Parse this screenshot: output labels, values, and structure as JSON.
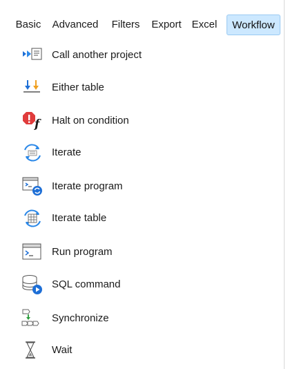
{
  "tabs": [
    {
      "label": "Basic",
      "active": false
    },
    {
      "label": "Advanced",
      "active": false
    },
    {
      "label": "Filters",
      "active": false
    },
    {
      "label": "Export",
      "active": false
    },
    {
      "label": "Excel",
      "active": false
    },
    {
      "label": "Workflow",
      "active": true
    }
  ],
  "items": [
    {
      "label": "Call another project",
      "icon": "call-project-icon"
    },
    {
      "label": "Either table",
      "icon": "either-table-icon"
    },
    {
      "label": "Halt on condition",
      "icon": "halt-condition-icon"
    },
    {
      "label": "Iterate",
      "icon": "iterate-icon"
    },
    {
      "label": "Iterate program",
      "icon": "iterate-program-icon"
    },
    {
      "label": "Iterate table",
      "icon": "iterate-table-icon"
    },
    {
      "label": "Run program",
      "icon": "run-program-icon"
    },
    {
      "label": "SQL command",
      "icon": "sql-command-icon"
    },
    {
      "label": "Synchronize",
      "icon": "synchronize-icon"
    },
    {
      "label": "Wait",
      "icon": "wait-icon"
    }
  ],
  "colors": {
    "accent_tab_bg": "#cce8ff",
    "accent_tab_border": "#99c9f2",
    "icon_blue": "#1e6fd6",
    "icon_red": "#e03c3c",
    "icon_orange": "#f0a020",
    "icon_green": "#2a9d3a"
  }
}
